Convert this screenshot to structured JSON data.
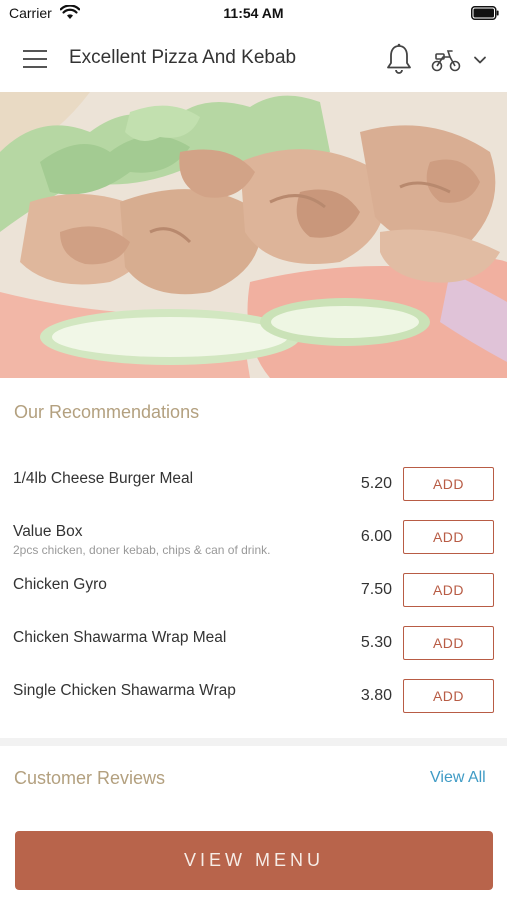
{
  "status_bar": {
    "carrier": "Carrier",
    "time": "11:54 AM",
    "icons": [
      "wifi-icon",
      "battery-icon"
    ]
  },
  "header": {
    "title": "Excellent Pizza And Kebab",
    "icons": [
      "menu-icon",
      "bell-icon",
      "scooter-icon",
      "chevron-down-icon"
    ]
  },
  "hero": {
    "image": "food-photo"
  },
  "recommendations": {
    "title": "Our Recommendations",
    "add_label": "ADD",
    "items": [
      {
        "name": "1/4lb Cheese Burger Meal",
        "description": "",
        "price": "5.20"
      },
      {
        "name": "Value Box",
        "description": "2pcs chicken, doner kebab, chips & can of drink.",
        "price": "6.00"
      },
      {
        "name": "Chicken Gyro",
        "description": "",
        "price": "7.50"
      },
      {
        "name": "Chicken Shawarma Wrap Meal",
        "description": "",
        "price": "5.30"
      },
      {
        "name": "Single Chicken Shawarma Wrap",
        "description": "",
        "price": "3.80"
      }
    ]
  },
  "reviews": {
    "title": "Customer Reviews",
    "view_all": "View All"
  },
  "footer": {
    "view_menu": "VIEW MENU"
  },
  "colors": {
    "accent": "#b8644b",
    "section_title": "#b3a07f",
    "link": "#3f9bc5"
  }
}
